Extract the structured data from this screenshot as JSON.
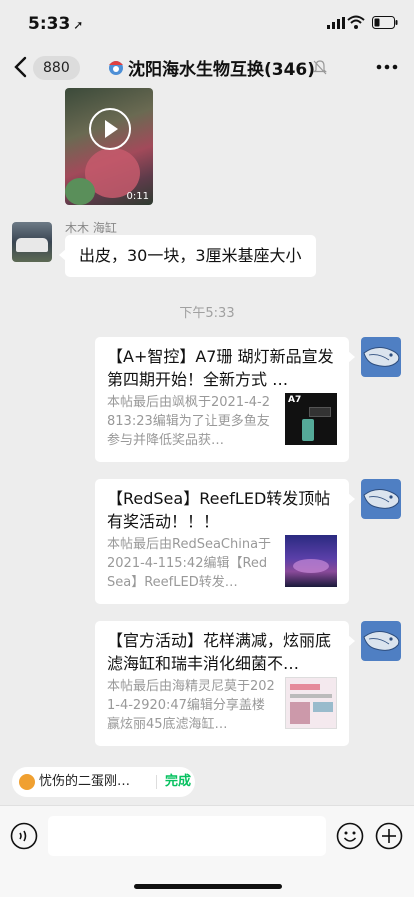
{
  "status_bar": {
    "time": "5:33"
  },
  "header": {
    "unread_count": "880",
    "title": "沈阳海水生物互换(346)"
  },
  "messages": {
    "video": {
      "duration": "0:11"
    },
    "text_msg": {
      "sender": "木木 海缸",
      "text": "出皮，30一块，3厘米基座大小"
    },
    "timestamp": "下午5:33",
    "cards": [
      {
        "title": "【A+智控】A7珊 瑚灯新品宣发 第四期开始！全新方式 …",
        "desc": "本帖最后由飒枫于2021-4-2813:23编辑为了让更多鱼友参与并降低奖品获…",
        "thumb_text": "A7"
      },
      {
        "title": "【RedSea】ReefLED转发顶帖有奖活动！！！",
        "desc": "本帖最后由RedSeaChina于2021-4-115:42编辑【RedSea】ReefLED转发…"
      },
      {
        "title": "【官方活动】花样满减，炫丽底滤海缸和瑞丰消化细菌不…",
        "desc": "本帖最后由海精灵尼莫于2021-4-2920:47编辑分享盖楼赢炫丽45底滤海缸…"
      }
    ]
  },
  "quote": {
    "text": "忧伤的二蛋刚…",
    "done_label": "完成"
  },
  "input": {
    "value": ""
  },
  "colors": {
    "background": "#ededed",
    "accent": "#07c160",
    "self_avatar": "#4f7fc3"
  }
}
